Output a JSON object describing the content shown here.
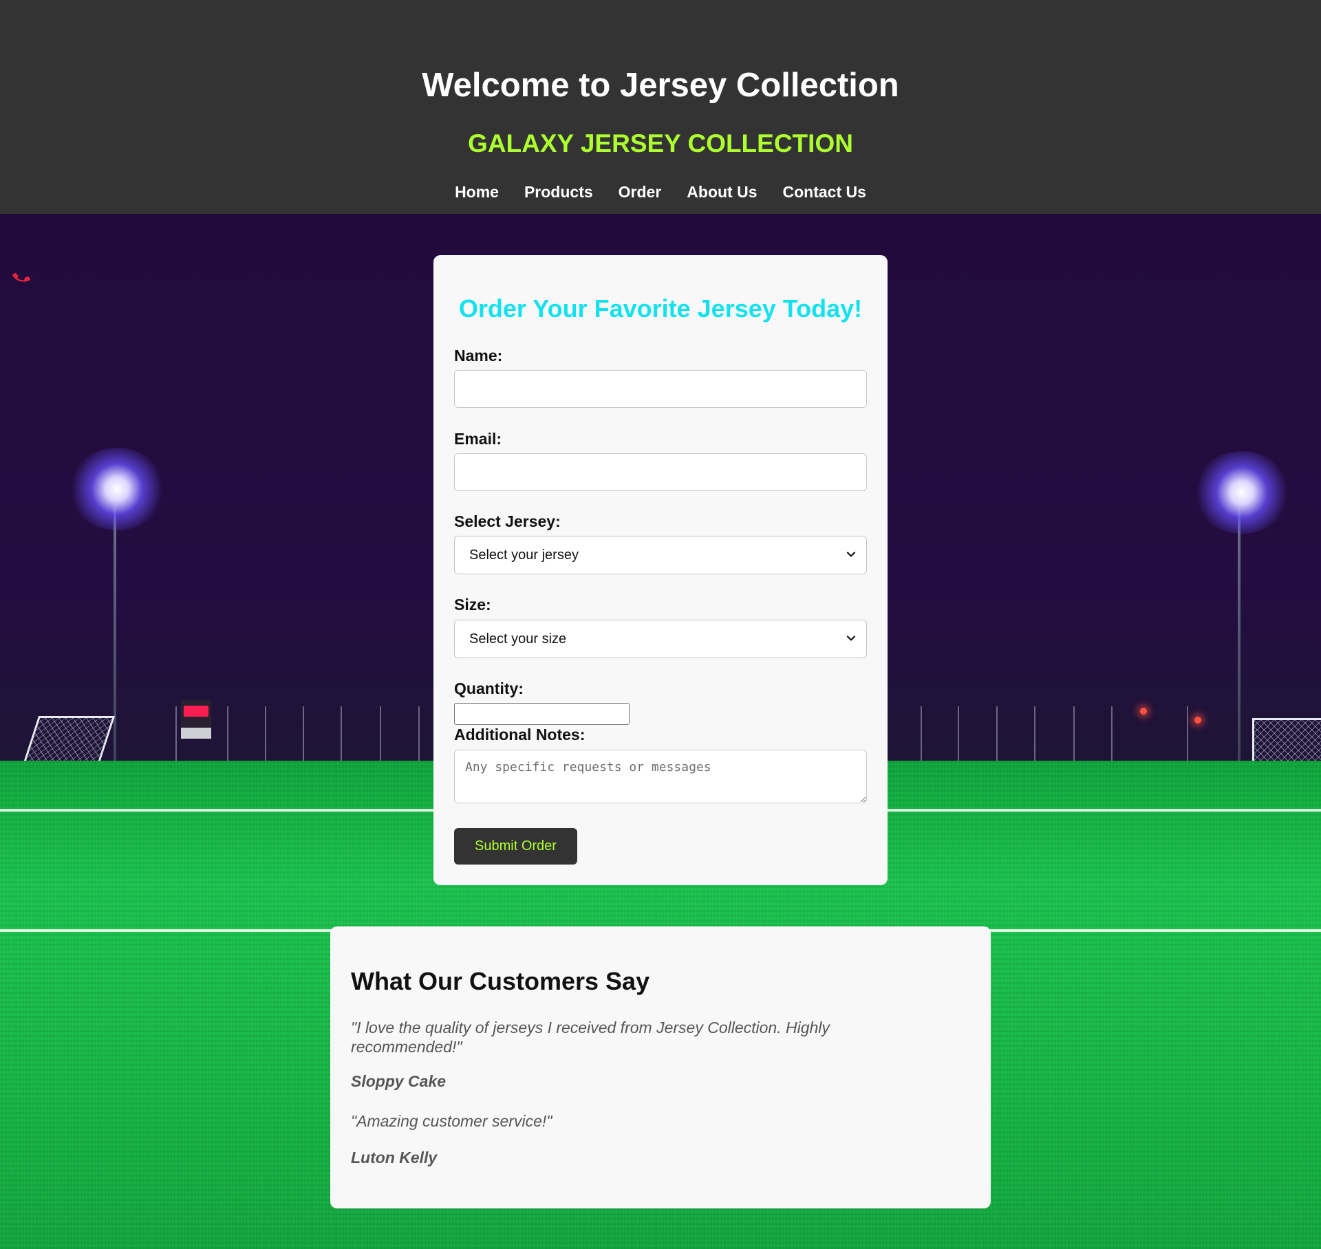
{
  "header": {
    "title": "Welcome to Jersey Collection",
    "brand": "GALAXY JERSEY COLLECTION",
    "nav": [
      "Home",
      "Products",
      "Order",
      "About Us",
      "Contact Us"
    ]
  },
  "order_form": {
    "heading": "Order Your Favorite Jersey Today!",
    "name_label": "Name:",
    "name_value": "",
    "email_label": "Email:",
    "email_value": "",
    "jersey_label": "Select Jersey:",
    "jersey_selected": "Select your jersey",
    "size_label": "Size:",
    "size_selected": "Select your size",
    "quantity_label": "Quantity:",
    "quantity_value": "",
    "notes_label": "Additional Notes:",
    "notes_placeholder": "Any specific requests or messages",
    "submit_label": "Submit Order"
  },
  "testimonials": {
    "heading": "What Our Customers Say",
    "items": [
      {
        "quote": "\"I love the quality of jerseys I received from Jersey Collection. Highly recommended!\"",
        "author": "Sloppy Cake"
      },
      {
        "quote": "\"Amazing customer service!\"",
        "author": "Luton Kelly"
      }
    ]
  },
  "icons": {
    "phone": "phone-icon",
    "dropdown": "chevron-down-icon"
  },
  "colors": {
    "header_bg": "#333333",
    "brand": "#adff2f",
    "form_heading": "#13e2ee",
    "phone_icon": "#e8233d",
    "card_bg": "#f8f8f8"
  }
}
